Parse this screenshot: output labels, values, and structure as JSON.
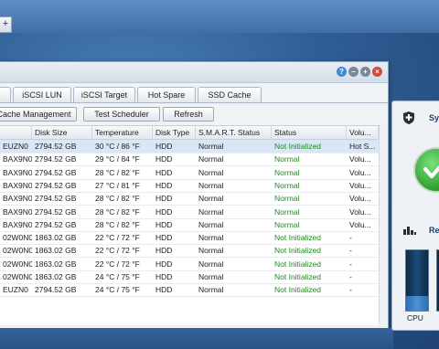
{
  "topbar": {
    "plus": "+"
  },
  "window": {
    "controls": {
      "help": "?",
      "minimize": "–",
      "maximize": "+",
      "close": "×"
    },
    "tabs": [
      "",
      "iSCSI LUN",
      "iSCSI Target",
      "Hot Spare",
      "SSD Cache"
    ],
    "toolbar": [
      "Cache Management",
      "Test Scheduler",
      "Refresh"
    ],
    "columns": [
      "",
      "Disk Size",
      "Temperature",
      "Disk Type",
      "S.M.A.R.T. Status",
      "Status",
      "Volu..."
    ],
    "rows": [
      {
        "id": "EUZN0",
        "size": "2794.52 GB",
        "temp": "30 °C / 86 °F",
        "type": "HDD",
        "smart": "Normal",
        "status": "Not Initialized",
        "vol": "Hot S..."
      },
      {
        "id": "BAX9N0",
        "size": "2794.52 GB",
        "temp": "29 °C / 84 °F",
        "type": "HDD",
        "smart": "Normal",
        "status": "Normal",
        "vol": "Volu..."
      },
      {
        "id": "BAX9N0",
        "size": "2794.52 GB",
        "temp": "28 °C / 82 °F",
        "type": "HDD",
        "smart": "Normal",
        "status": "Normal",
        "vol": "Volu..."
      },
      {
        "id": "BAX9N0",
        "size": "2794.52 GB",
        "temp": "27 °C / 81 °F",
        "type": "HDD",
        "smart": "Normal",
        "status": "Normal",
        "vol": "Volu..."
      },
      {
        "id": "BAX9N0",
        "size": "2794.52 GB",
        "temp": "28 °C / 82 °F",
        "type": "HDD",
        "smart": "Normal",
        "status": "Normal",
        "vol": "Volu..."
      },
      {
        "id": "BAX9N0",
        "size": "2794.52 GB",
        "temp": "28 °C / 82 °F",
        "type": "HDD",
        "smart": "Normal",
        "status": "Normal",
        "vol": "Volu..."
      },
      {
        "id": "BAX9N0",
        "size": "2794.52 GB",
        "temp": "28 °C / 82 °F",
        "type": "HDD",
        "smart": "Normal",
        "status": "Normal",
        "vol": "Volu..."
      },
      {
        "id": "02W0N0",
        "size": "1863.02 GB",
        "temp": "22 °C / 72 °F",
        "type": "HDD",
        "smart": "Normal",
        "status": "Not Initialized",
        "vol": "-"
      },
      {
        "id": "02W0N0",
        "size": "1863.02 GB",
        "temp": "22 °C / 72 °F",
        "type": "HDD",
        "smart": "Normal",
        "status": "Not Initialized",
        "vol": "-"
      },
      {
        "id": "02W0N0",
        "size": "1863.02 GB",
        "temp": "22 °C / 72 °F",
        "type": "HDD",
        "smart": "Normal",
        "status": "Not Initialized",
        "vol": "-"
      },
      {
        "id": "02W0N0",
        "size": "1863.02 GB",
        "temp": "24 °C / 75 °F",
        "type": "HDD",
        "smart": "Normal",
        "status": "Not Initialized",
        "vol": "-"
      },
      {
        "id": "EUZN0",
        "size": "2794.52 GB",
        "temp": "24 °C / 75 °F",
        "type": "HDD",
        "smart": "Normal",
        "status": "Not Initialized",
        "vol": "-"
      }
    ]
  },
  "side_panel": {
    "health_title": "Sy",
    "resource_title": "Re",
    "cpu_label": "CPU",
    "cpu_usage_fraction": 0.25
  },
  "colors": {
    "status_green": "#1e8a1e",
    "selected_row": "#d9e6f6"
  }
}
